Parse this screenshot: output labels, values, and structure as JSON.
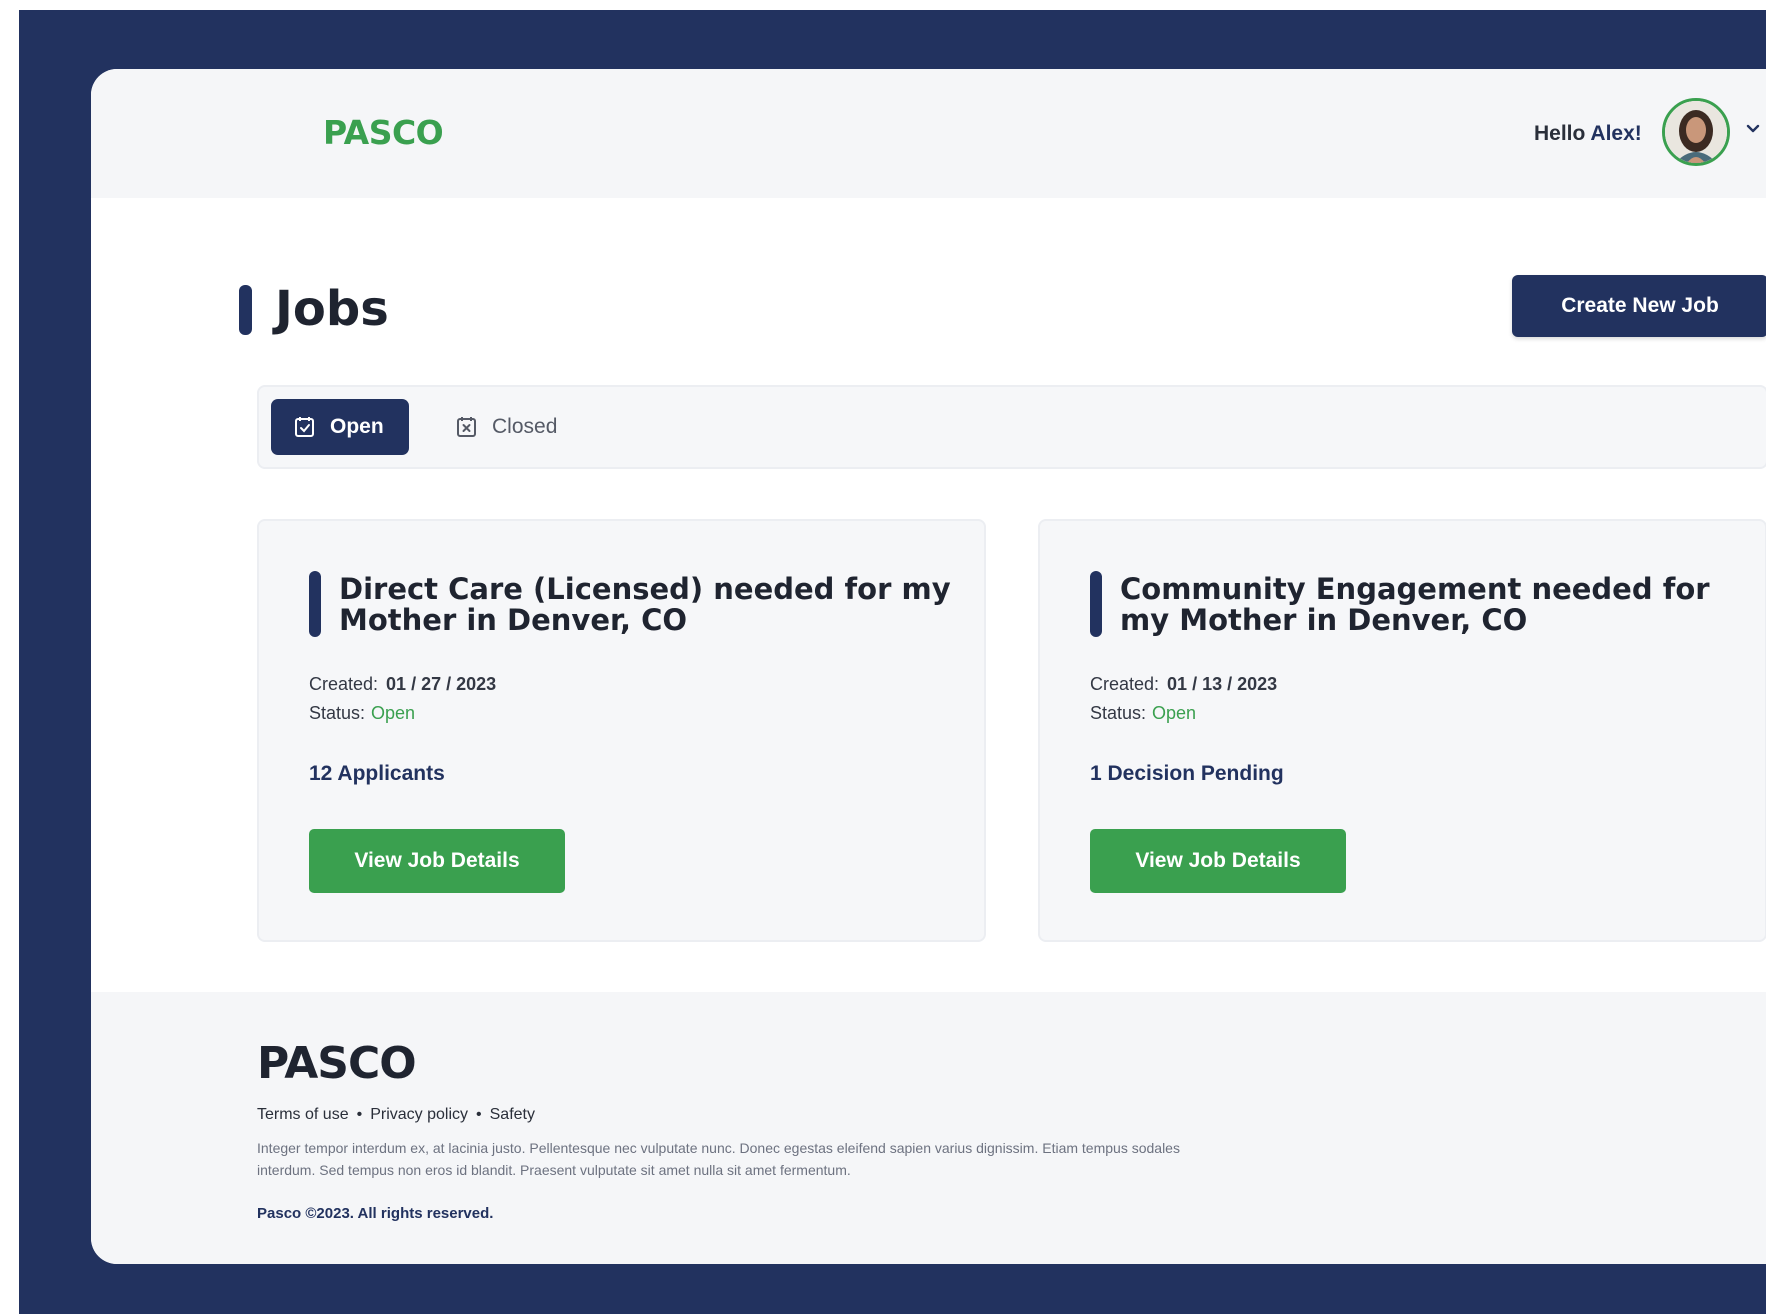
{
  "header": {
    "logo": "PASCO",
    "greeting_prefix": "Hello ",
    "user_name": "Alex!"
  },
  "page": {
    "title": "Jobs",
    "create_label": "Create New Job"
  },
  "tabs": [
    {
      "label": "Open",
      "active": true
    },
    {
      "label": "Closed",
      "active": false
    }
  ],
  "jobs": [
    {
      "title": "Direct Care (Licensed) needed for my Mother in Denver, CO",
      "created_label": "Created:",
      "created": "01 / 27 / 2023",
      "status_label": "Status:",
      "status": "Open",
      "count": "12 Applicants",
      "action": "View Job Details"
    },
    {
      "title": "Community Engagement needed for my Mother in Denver, CO",
      "created_label": "Created:",
      "created": "01 / 13 / 2023",
      "status_label": "Status:",
      "status": "Open",
      "count": "1 Decision Pending",
      "action": "View Job Details"
    }
  ],
  "footer": {
    "logo": "PASCO",
    "links": [
      "Terms of use",
      "Privacy policy",
      "Safety"
    ],
    "text": "Integer tempor interdum ex, at lacinia justo. Pellentesque nec vulputate nunc. Donec egestas eleifend sapien varius dignissim. Etiam tempus sodales interdum. Sed tempus non eros id blandit. Praesent vulputate sit amet nulla sit amet fermentum.",
    "copyright": "Pasco ©2023.  All rights reserved."
  },
  "colors": {
    "navy": "#22325f",
    "green": "#3aa04f",
    "surface": "#f6f7f9"
  },
  "icons": {
    "open_tab": "checked-calendar-icon",
    "closed_tab": "x-box-icon",
    "dropdown": "chevron-down-icon"
  }
}
